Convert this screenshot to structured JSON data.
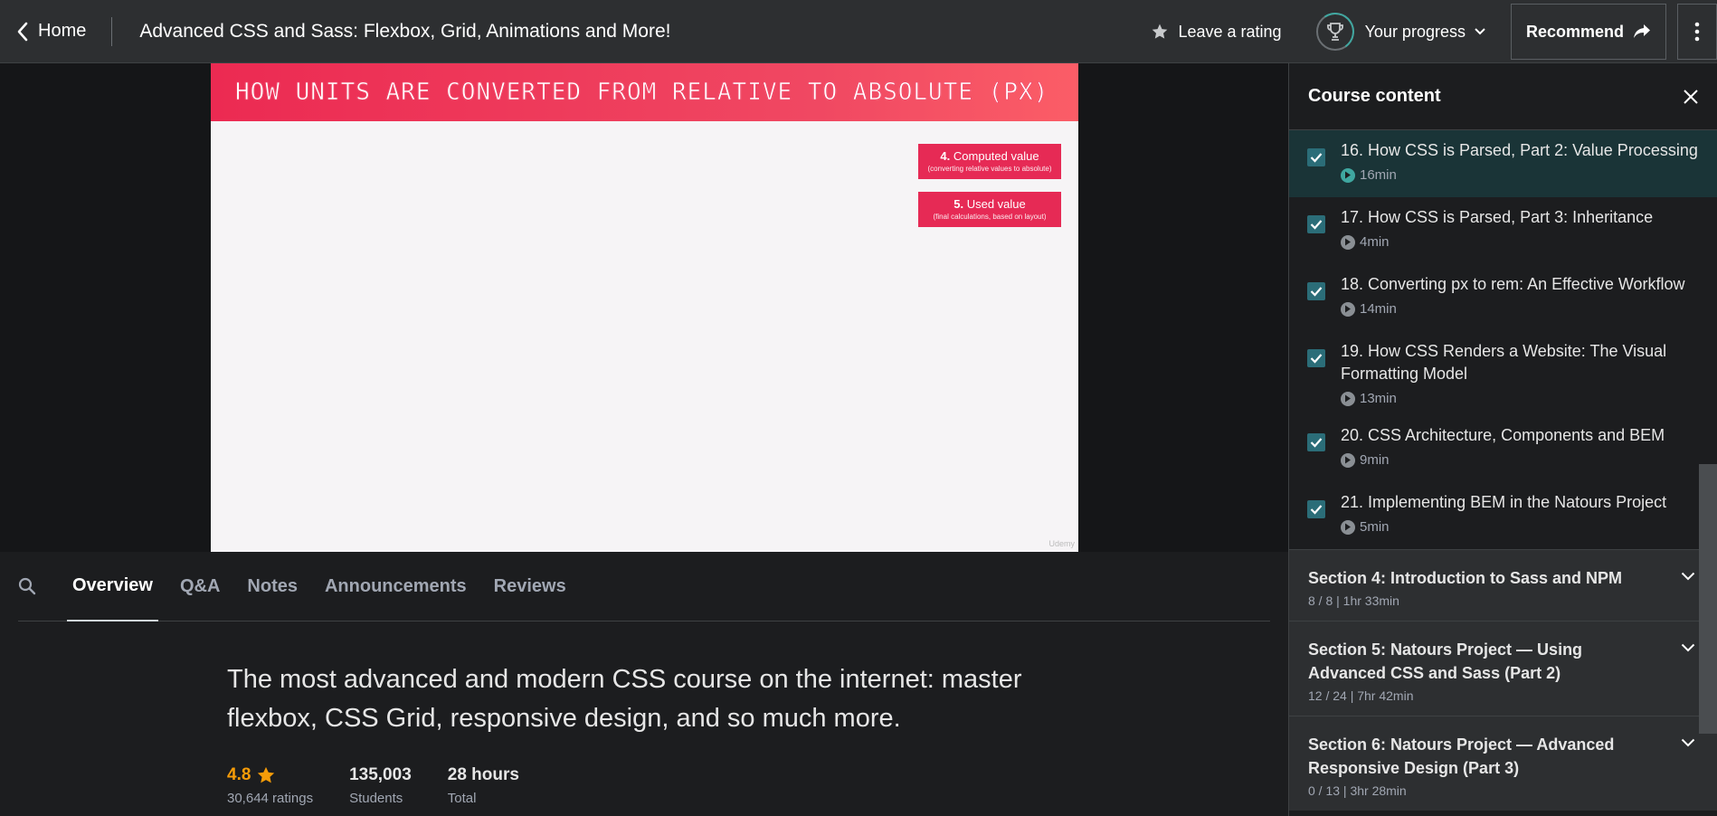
{
  "header": {
    "home_label": "Home",
    "course_title": "Advanced CSS and Sass: Flexbox, Grid, Animations and More!",
    "rating_label": "Leave a rating",
    "progress_label": "Your progress",
    "recommend_label": "Recommend"
  },
  "slide": {
    "title": "HOW UNITS ARE CONVERTED FROM RELATIVE TO ABSOLUTE (PX)",
    "box1": {
      "num": "4.",
      "label": "Computed value",
      "sub": "(converting relative values to absolute)"
    },
    "box2": {
      "num": "5.",
      "label": "Used value",
      "sub": "(final calculations, based on layout)"
    },
    "watermark": "Udemy"
  },
  "tabs": [
    "Overview",
    "Q&A",
    "Notes",
    "Announcements",
    "Reviews"
  ],
  "active_tab": "Overview",
  "overview": {
    "headline": "The most advanced and modern CSS course on the internet: master flexbox, CSS Grid, responsive design, and so much more.",
    "rating": {
      "value": "4.8",
      "label": "30,644 ratings"
    },
    "students": {
      "value": "135,003",
      "label": "Students"
    },
    "hours": {
      "value": "28 hours",
      "label": "Total"
    }
  },
  "sidebar": {
    "title": "Course content",
    "lectures": [
      {
        "title": "16. How CSS is Parsed, Part 2: Value Processing",
        "duration": "16min",
        "active": true,
        "completed": true
      },
      {
        "title": "17. How CSS is Parsed, Part 3: Inheritance",
        "duration": "4min",
        "active": false,
        "completed": true
      },
      {
        "title": "18. Converting px to rem: An Effective Workflow",
        "duration": "14min",
        "active": false,
        "completed": true
      },
      {
        "title": "19. How CSS Renders a Website: The Visual Formatting Model",
        "duration": "13min",
        "active": false,
        "completed": true
      },
      {
        "title": "20. CSS Architecture, Components and BEM",
        "duration": "9min",
        "active": false,
        "completed": true
      },
      {
        "title": "21. Implementing BEM in the Natours Project",
        "duration": "5min",
        "active": false,
        "completed": true
      }
    ],
    "sections": [
      {
        "title": "Section 4: Introduction to Sass and NPM",
        "meta": "8 / 8 | 1hr 33min"
      },
      {
        "title": "Section 5: Natours Project — Using Advanced CSS and Sass (Part 2)",
        "meta": "12 / 24 | 7hr 42min"
      },
      {
        "title": "Section 6: Natours Project — Advanced Responsive Design (Part 3)",
        "meta": "0 / 13 | 3hr 28min"
      }
    ]
  },
  "colors": {
    "accent_teal": "#3fa7a0",
    "rating_orange": "#f69c08",
    "slide_red": "#e62a55",
    "active_row_bg": "#1a3437"
  }
}
